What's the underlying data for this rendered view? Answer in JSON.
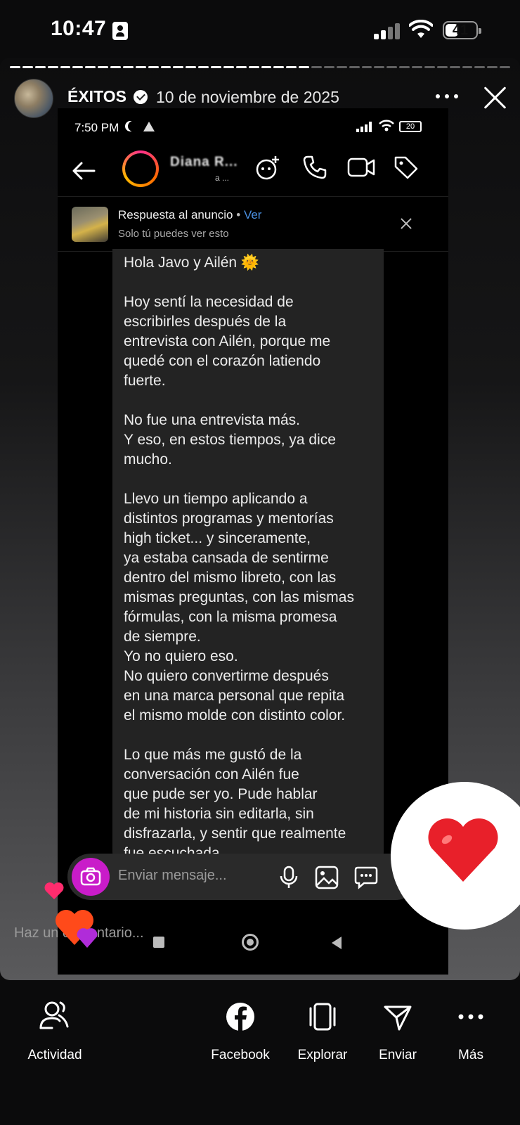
{
  "status_bar": {
    "time": "10:47",
    "battery": "41"
  },
  "story": {
    "username": "ÉXITOS",
    "date": "10 de noviembre de 2025",
    "comment_placeholder": "Haz un comentario..."
  },
  "screenshot": {
    "time": "7:50 PM",
    "battery": "20",
    "chat_name": "Diana R...",
    "chat_sub": "a ...",
    "ad_reply": {
      "title": "Respuesta al anuncio",
      "separator": "•",
      "link": "Ver",
      "subtitle": "Solo tú puedes ver esto"
    },
    "message_paragraphs": [
      "Hola Javo y Ailén 🌞",
      "Hoy sentí la necesidad de\nescribirles después de la\nentrevista con Ailén, porque me\nquedé con el corazón latiendo\nfuerte.",
      "No fue una entrevista más.\nY eso, en estos tiempos, ya dice\nmucho.",
      "Llevo un tiempo aplicando a\ndistintos programas y mentorías\nhigh ticket... y sinceramente,\nya estaba cansada de sentirme\ndentro del mismo libreto, con las\nmismas preguntas, con las mismas\nfórmulas, con la misma promesa\nde siempre.\nYo no quiero eso.\nNo quiero convertirme después\nen una marca personal que repita\nel mismo molde con distinto color.",
      "Lo que más me gustó de la\nconversación con Ailén fue\nque pude ser yo. Pude hablar\nde mi historia sin editarla, sin\ndisfrazarla, y sentir que realmente\nfue escuchada."
    ],
    "composer_placeholder": "Enviar mensaje..."
  },
  "actions": [
    {
      "label": "Actividad",
      "icon": "activity-icon"
    },
    {
      "label": "Facebook",
      "icon": "facebook-icon"
    },
    {
      "label": "Explorar",
      "icon": "explore-icon"
    },
    {
      "label": "Enviar",
      "icon": "send-icon"
    },
    {
      "label": "Más",
      "icon": "more-icon"
    }
  ],
  "colors": {
    "camera_button": "#c91cc9",
    "link": "#4a90e2",
    "heart": "#e8202a"
  }
}
